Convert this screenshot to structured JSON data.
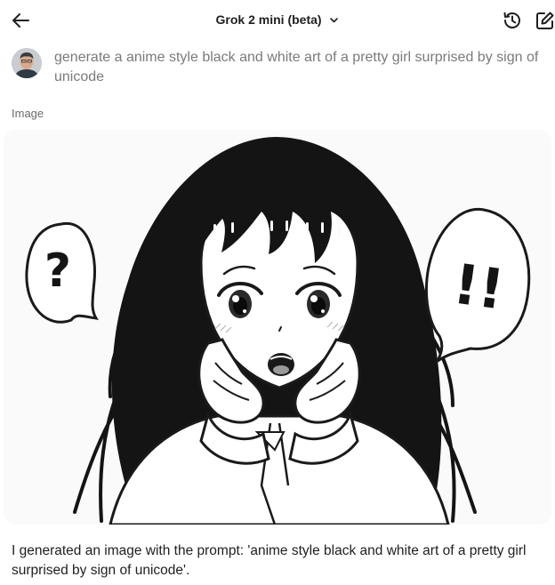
{
  "header": {
    "model_name": "Grok 2 mini (beta)"
  },
  "user_message": {
    "text": "generate a anime style black and white art of a pretty girl surprised by sign of unicode"
  },
  "attachment": {
    "label": "Image",
    "bubble_left_text": "?",
    "bubble_right_text": "!!"
  },
  "assistant_message": {
    "text": "I generated an image with the prompt: 'anime style black and white art of a pretty girl surprised by sign of unicode'."
  }
}
